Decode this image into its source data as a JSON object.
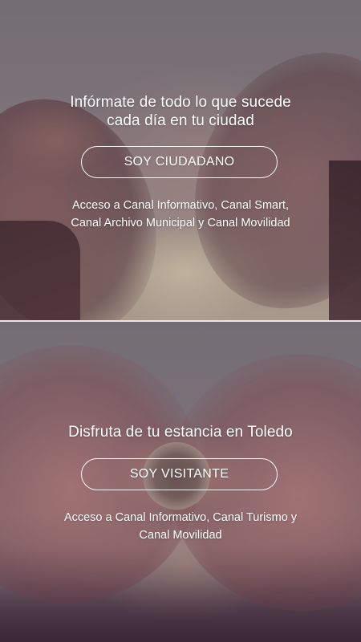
{
  "citizen": {
    "headline_line1": "Infórmate de todo lo que sucede",
    "headline_line2": "cada día en tu ciudad",
    "button_label": "SOY CIUDADANO",
    "description_line1": "Acceso a Canal Informativo, Canal Smart,",
    "description_line2": "Canal Archivo Municipal y Canal Movilidad"
  },
  "visitor": {
    "headline": "Disfruta de tu estancia en Toledo",
    "button_label": "SOY VISITANTE",
    "description_line1": "Acceso a Canal Informativo, Canal Turismo y",
    "description_line2": "Canal Movilidad"
  },
  "colors": {
    "text": "#ffffff",
    "divider": "#e9e6ea",
    "overlay": "#2d232d"
  }
}
